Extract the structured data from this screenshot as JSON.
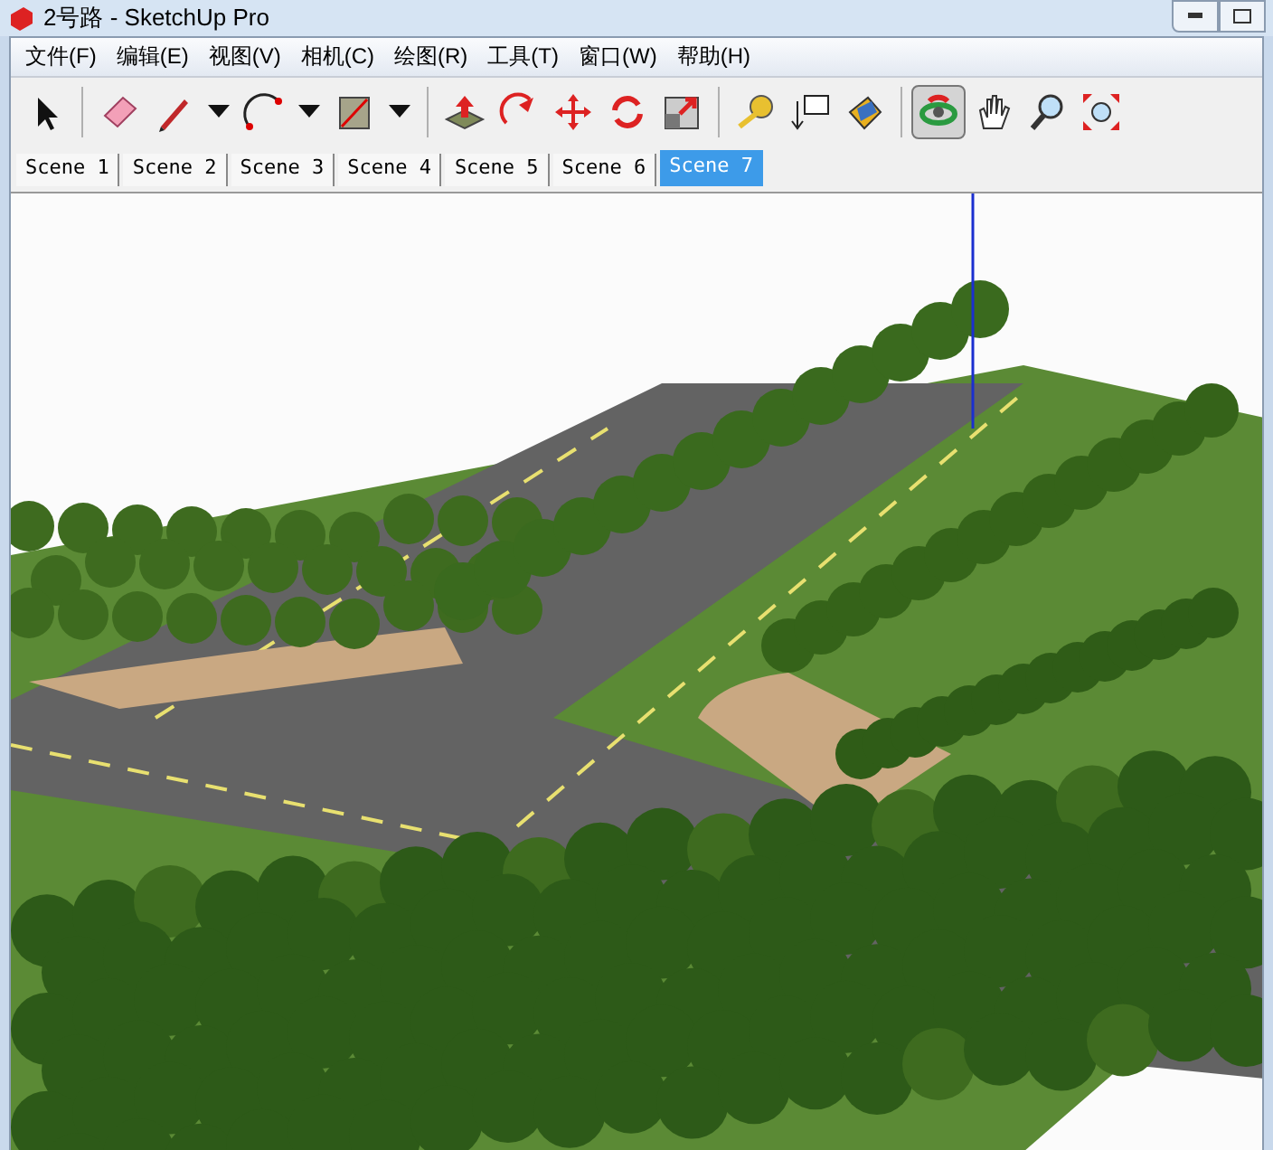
{
  "window": {
    "title": "2号路 - SketchUp Pro"
  },
  "menu": [
    "文件(F)",
    "编辑(E)",
    "视图(V)",
    "相机(C)",
    "绘图(R)",
    "工具(T)",
    "窗口(W)",
    "帮助(H)"
  ],
  "toolbar": {
    "groups": [
      {
        "tools": [
          {
            "selected": false,
            "dropdown": false
          }
        ]
      },
      {
        "tools": [
          {
            "selected": false,
            "dropdown": false
          },
          {
            "selected": false,
            "dropdown": true
          },
          {
            "selected": false,
            "dropdown": true
          },
          {
            "selected": false,
            "dropdown": true
          }
        ]
      },
      {
        "tools": [
          {
            "selected": false,
            "dropdown": false
          },
          {
            "selected": false,
            "dropdown": false
          },
          {
            "selected": false,
            "dropdown": false
          },
          {
            "selected": false,
            "dropdown": false
          },
          {
            "selected": false,
            "dropdown": false
          }
        ]
      },
      {
        "tools": [
          {
            "selected": false,
            "dropdown": false
          },
          {
            "selected": false,
            "dropdown": false
          },
          {
            "selected": false,
            "dropdown": false
          }
        ]
      },
      {
        "tools": [
          {
            "selected": true,
            "dropdown": false
          },
          {
            "selected": false,
            "dropdown": false
          },
          {
            "selected": false,
            "dropdown": false
          },
          {
            "selected": false,
            "dropdown": false
          }
        ]
      }
    ]
  },
  "scene_tabs": [
    {
      "label": "Scene 1",
      "selected": false
    },
    {
      "label": "Scene 2",
      "selected": false
    },
    {
      "label": "Scene 3",
      "selected": false
    },
    {
      "label": "Scene 4",
      "selected": false
    },
    {
      "label": "Scene 5",
      "selected": false
    },
    {
      "label": "Scene 6",
      "selected": false
    },
    {
      "label": "Scene 7",
      "selected": true
    }
  ]
}
